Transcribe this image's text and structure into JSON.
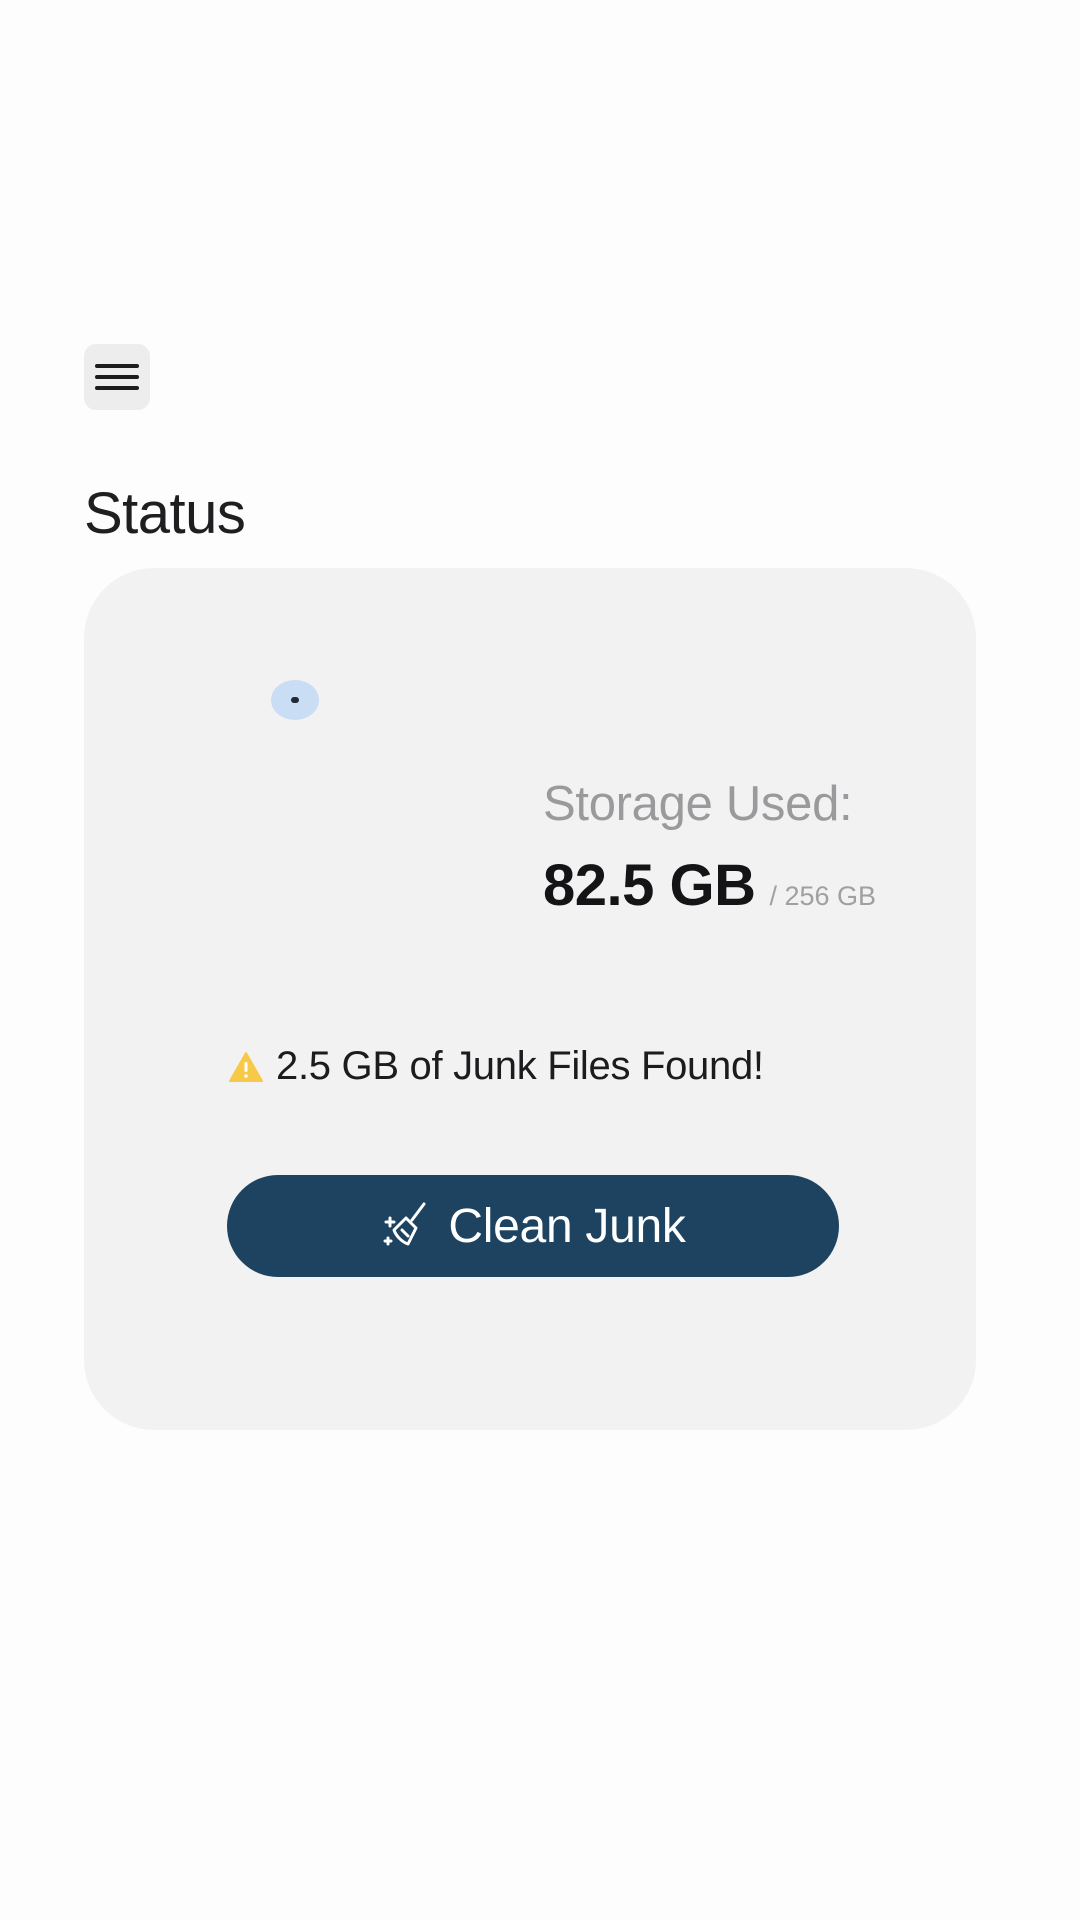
{
  "header": {
    "menu_icon": "hamburger-menu-icon"
  },
  "page": {
    "title": "Status"
  },
  "status_card": {
    "storage_label": "Storage Used:",
    "storage_used": "82.5 GB",
    "storage_total": "/ 256 GB",
    "junk_icon": "warning-icon",
    "junk_message": "2.5 GB of Junk Files Found!",
    "clean_button": {
      "icon": "broom-sparkle-icon",
      "label": "Clean Junk"
    }
  },
  "colors": {
    "accent": "#1d4361",
    "card_background": "#f2f2f3",
    "warning": "#f7c948",
    "muted_text": "#9a9a9d"
  }
}
